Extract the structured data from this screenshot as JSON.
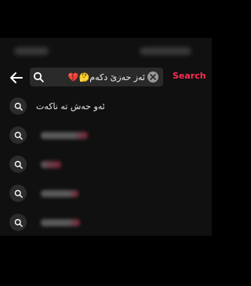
{
  "search": {
    "query": "ئەز حەزێ دکەم🤔💔",
    "action_label": "Search"
  },
  "suggestions": [
    {
      "label": "ئەو حەش تە ناکەت",
      "redacted": false
    },
    {
      "label": "",
      "redacted": true
    },
    {
      "label": "",
      "redacted": true
    },
    {
      "label": "",
      "redacted": true
    },
    {
      "label": "",
      "redacted": true
    }
  ],
  "colors": {
    "accent": "#fe2c55",
    "background": "#101010",
    "letterbox": "#000000"
  },
  "icons": {
    "back": "arrow-left-icon",
    "search": "search-icon",
    "clear": "clear-icon"
  }
}
